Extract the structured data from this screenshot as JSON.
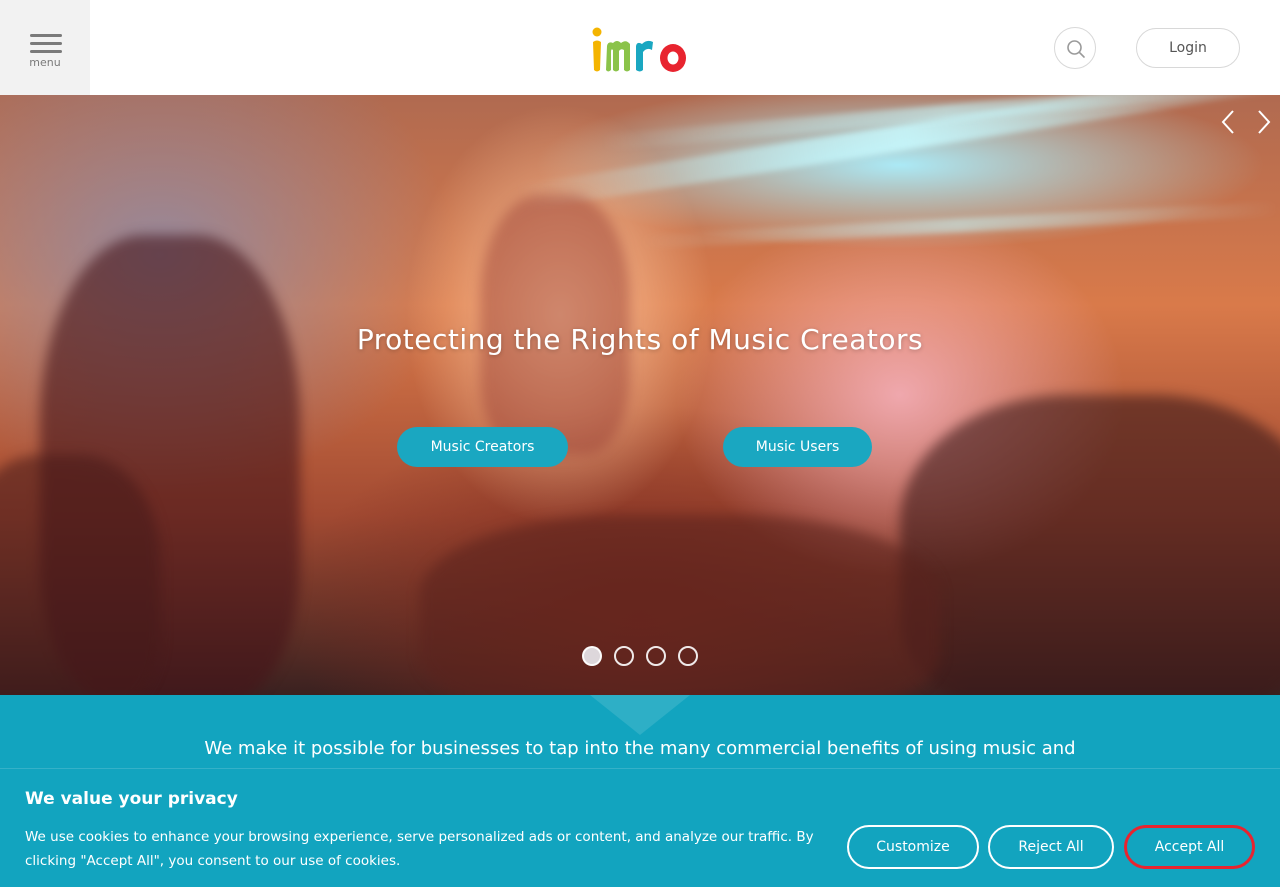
{
  "header": {
    "menu_label": "menu",
    "logo_text": "imro",
    "login_label": "Login",
    "search_icon": "search-icon"
  },
  "hero": {
    "title": "Protecting the Rights of Music Creators",
    "buttons": [
      "Music Creators",
      "Music Users"
    ],
    "carousel": {
      "slide_count": 4,
      "active_index": 0
    },
    "arrows": [
      "chevron-left-icon",
      "chevron-right-icon"
    ]
  },
  "intro": {
    "text": "We make it possible for businesses to tap into the many commercial benefits of using music and"
  },
  "cookie": {
    "title": "We value your privacy",
    "text": "We use cookies to enhance your browsing experience, serve personalized ads or content, and analyze our traffic. By clicking \"Accept All\", you consent to our use of cookies.",
    "customize_label": "Customize",
    "reject_label": "Reject All",
    "accept_label": "Accept All"
  },
  "colors": {
    "teal": "#12a4bf",
    "button_teal": "#1aa7c1",
    "accept_border": "#e8242f",
    "logo_i": "#f4b400",
    "logo_m": "#8bc34a",
    "logo_r": "#1aa7c1",
    "logo_o": "#e8242f"
  }
}
